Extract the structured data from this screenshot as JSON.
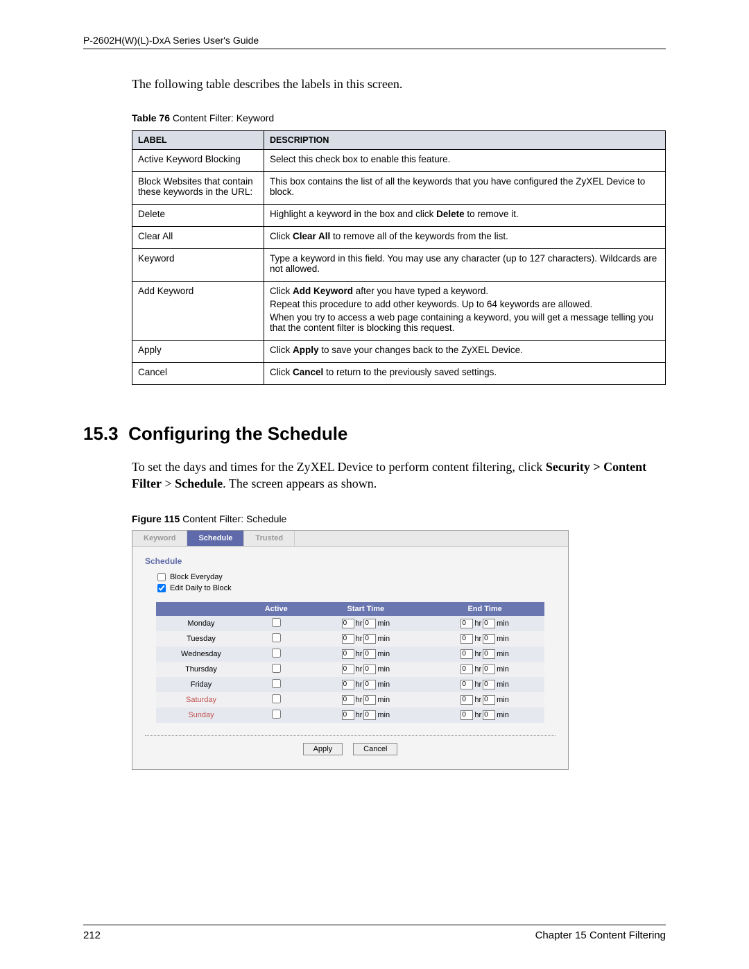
{
  "header": "P-2602H(W)(L)-DxA Series User's Guide",
  "intro": "The following table describes the labels in this screen.",
  "table76": {
    "caption_bold": "Table 76",
    "caption_rest": "   Content Filter: Keyword",
    "head_label": "LABEL",
    "head_desc": "DESCRIPTION",
    "rows": [
      {
        "label": "Active Keyword Blocking",
        "paras": [
          "Select this check box to enable this feature."
        ]
      },
      {
        "label": "Block Websites that contain these keywords in the URL:",
        "paras": [
          "This box contains the list of all the keywords that you have configured the ZyXEL Device to block."
        ]
      },
      {
        "label": "Delete",
        "paras": [
          "Highlight a keyword in the box and click <b>Delete</b> to remove it."
        ]
      },
      {
        "label": "Clear All",
        "paras": [
          "Click <b>Clear All</b> to remove all of the keywords from the list."
        ]
      },
      {
        "label": "Keyword",
        "paras": [
          "Type a keyword in this field. You may use any character (up to 127 characters). Wildcards are not allowed."
        ]
      },
      {
        "label": "Add Keyword",
        "paras": [
          "Click <b>Add Keyword</b> after you have typed a keyword.",
          "Repeat this procedure to add other keywords. Up to 64 keywords are allowed.",
          "When you try to access a web page containing a keyword, you will get a message telling you that the content filter is blocking this request."
        ]
      },
      {
        "label": "Apply",
        "paras": [
          "Click <b>Apply</b> to save your changes back to the ZyXEL Device."
        ]
      },
      {
        "label": "Cancel",
        "paras": [
          "Click <b>Cancel</b> to return to the previously saved settings."
        ]
      }
    ]
  },
  "section": {
    "number": "15.3",
    "title": "Configuring the Schedule"
  },
  "body_paragraph": "To set the days and times for the ZyXEL Device to perform content filtering, click <b>Security > Content Filter</b> > <b>Schedule</b>. The screen appears as shown.",
  "figure": {
    "caption_bold": "Figure 115",
    "caption_rest": "   Content Filter: Schedule",
    "tabs": [
      "Keyword",
      "Schedule",
      "Trusted"
    ],
    "active_tab": 1,
    "panel_heading": "Schedule",
    "opt_block_everyday": {
      "label": "Block Everyday",
      "checked": false
    },
    "opt_edit_daily": {
      "label": "Edit Daily to Block",
      "checked": true
    },
    "sched_head": [
      "",
      "Active",
      "Start Time",
      "End Time"
    ],
    "hr_label": "hr",
    "min_label": "min",
    "days": [
      {
        "name": "Monday",
        "weekend": false,
        "active": false,
        "start_hr": "0",
        "start_min": "0",
        "end_hr": "0",
        "end_min": "0"
      },
      {
        "name": "Tuesday",
        "weekend": false,
        "active": false,
        "start_hr": "0",
        "start_min": "0",
        "end_hr": "0",
        "end_min": "0"
      },
      {
        "name": "Wednesday",
        "weekend": false,
        "active": false,
        "start_hr": "0",
        "start_min": "0",
        "end_hr": "0",
        "end_min": "0"
      },
      {
        "name": "Thursday",
        "weekend": false,
        "active": false,
        "start_hr": "0",
        "start_min": "0",
        "end_hr": "0",
        "end_min": "0"
      },
      {
        "name": "Friday",
        "weekend": false,
        "active": false,
        "start_hr": "0",
        "start_min": "0",
        "end_hr": "0",
        "end_min": "0"
      },
      {
        "name": "Saturday",
        "weekend": true,
        "active": false,
        "start_hr": "0",
        "start_min": "0",
        "end_hr": "0",
        "end_min": "0"
      },
      {
        "name": "Sunday",
        "weekend": true,
        "active": false,
        "start_hr": "0",
        "start_min": "0",
        "end_hr": "0",
        "end_min": "0"
      }
    ],
    "buttons": {
      "apply": "Apply",
      "cancel": "Cancel"
    }
  },
  "footer": {
    "page_number": "212",
    "chapter": "Chapter 15 Content Filtering"
  }
}
